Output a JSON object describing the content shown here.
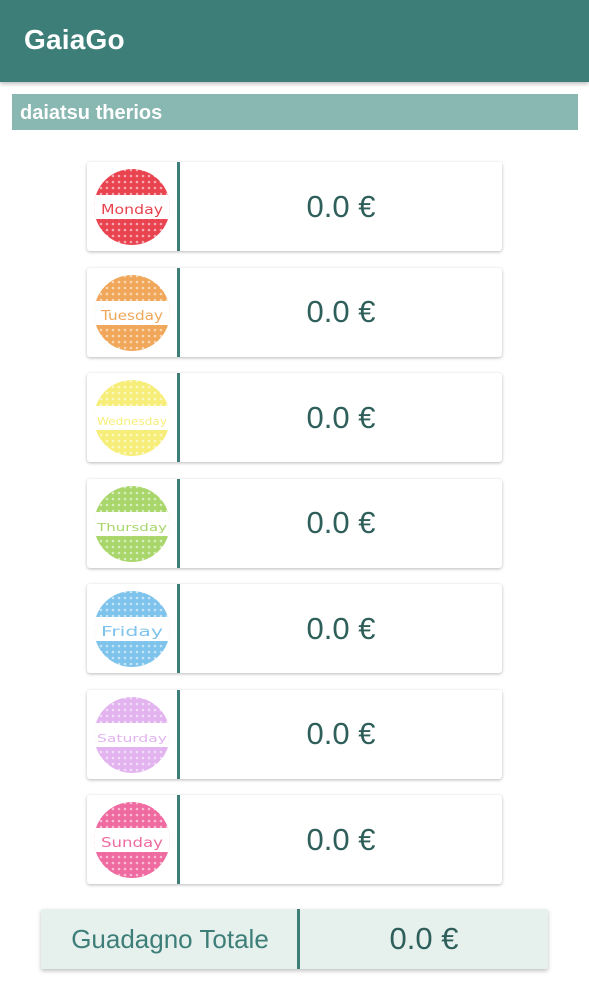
{
  "app": {
    "title": "GaiaGo"
  },
  "subheader": {
    "label": "daiatsu therios"
  },
  "days": [
    {
      "name": "Monday",
      "badge_text": "Monday",
      "color": "#e8434f",
      "amount": "0.0 €"
    },
    {
      "name": "Tuesday",
      "badge_text": "Tuesday",
      "color": "#f0a75a",
      "amount": "0.0 €"
    },
    {
      "name": "Wednesday",
      "badge_text": "Wednesday",
      "color": "#f7ee7a",
      "amount": "0.0 €"
    },
    {
      "name": "Thursday",
      "badge_text": "Thursday",
      "color": "#a8d66a",
      "amount": "0.0 €"
    },
    {
      "name": "Friday",
      "badge_text": "Friday",
      "color": "#7ec3ec",
      "amount": "0.0 €"
    },
    {
      "name": "Saturday",
      "badge_text": "Saturday",
      "color": "#e2b3ef",
      "amount": "0.0 €"
    },
    {
      "name": "Sunday",
      "badge_text": "Sunday",
      "color": "#ef6aa0",
      "amount": "0.0 €"
    }
  ],
  "total": {
    "label": "Guadagno Totale",
    "amount": "0.0 €"
  }
}
